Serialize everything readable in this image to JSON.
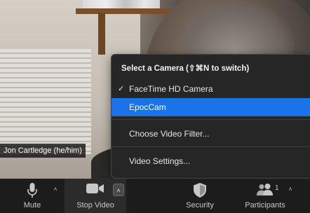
{
  "video": {
    "participant_name": "Jon Cartledge (he/him)"
  },
  "camera_menu": {
    "header": "Select a Camera (⇧⌘N to switch)",
    "items": [
      {
        "label": "FaceTime HD Camera",
        "checked": true,
        "highlighted": false
      },
      {
        "label": "EpocCam",
        "checked": false,
        "highlighted": true
      },
      {
        "label": "Choose Video Filter...",
        "checked": false,
        "highlighted": false
      },
      {
        "label": "Video Settings...",
        "checked": false,
        "highlighted": false
      }
    ],
    "check_glyph": "✓",
    "highlight_color": "#1a73e8"
  },
  "toolbar": {
    "mute_label": "Mute",
    "video_label": "Stop Video",
    "security_label": "Security",
    "participants_label": "Participants",
    "participants_count": "1",
    "chevron_glyph": "˄"
  },
  "icons": {
    "mute": "microphone-icon",
    "video": "video-camera-icon",
    "security": "shield-icon",
    "participants": "people-icon"
  }
}
